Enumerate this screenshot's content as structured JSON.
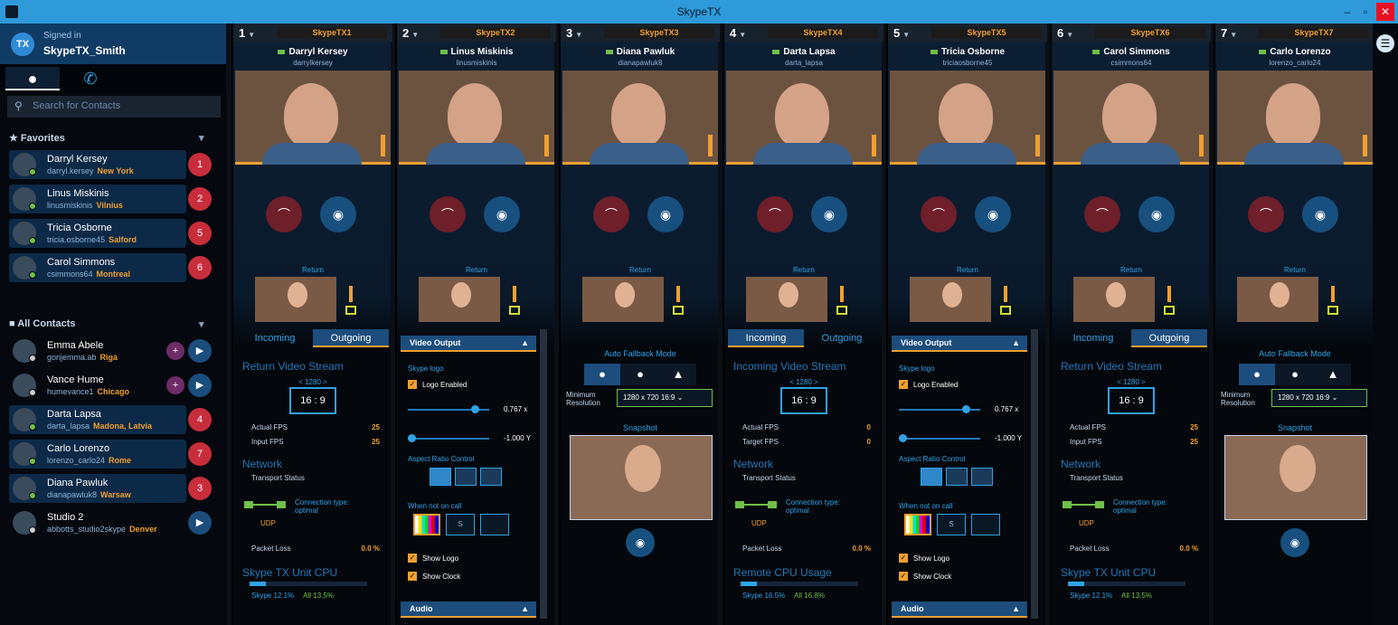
{
  "window": {
    "title": "SkypeTX",
    "minimize": "–",
    "maximize": "▫",
    "close": "✕"
  },
  "user": {
    "badge": "TX",
    "signed_in": "Signed in",
    "name": "SkypeTX_Smith"
  },
  "search": {
    "placeholder": "Search for Contacts"
  },
  "favorites": {
    "title": "Favorites",
    "items": [
      {
        "name": "Darryl Kersey",
        "handle": "darryl.kersey",
        "city": "New York",
        "call": "1",
        "presence": "online"
      },
      {
        "name": "Linus Miskinis",
        "handle": "linusmiskinis",
        "city": "Vilnius",
        "call": "2",
        "presence": "online"
      },
      {
        "name": "Tricia Osborne",
        "handle": "tricia.osborne45",
        "city": "Salford",
        "call": "5",
        "presence": "online"
      },
      {
        "name": "Carol Simmons",
        "handle": "csimmons64",
        "city": "Montreal",
        "call": "6",
        "presence": "online"
      }
    ]
  },
  "all_contacts": {
    "title": "All Contacts",
    "items": [
      {
        "name": "Emma Abele",
        "handle": "gorijemma.ab",
        "city": "Riga",
        "call": "",
        "presence": "offline",
        "mini": "+"
      },
      {
        "name": "Vance Hume",
        "handle": "humevance1",
        "city": "Chicago",
        "call": "",
        "presence": "offline",
        "mini": "+"
      },
      {
        "name": "Darta Lapsa",
        "handle": "darta_lapsa",
        "city": "Madona, Latvia",
        "call": "4",
        "presence": "online",
        "mini": ""
      },
      {
        "name": "Carlo Lorenzo",
        "handle": "lorenzo_carlo24",
        "city": "Rome",
        "call": "7",
        "presence": "online",
        "mini": ""
      },
      {
        "name": "Diana Pawluk",
        "handle": "dianapawluk8",
        "city": "Warsaw",
        "call": "3",
        "presence": "online",
        "mini": ""
      },
      {
        "name": "Studio 2",
        "handle": "abbotts_studio2skype",
        "city": "Denver",
        "call": "",
        "presence": "offline",
        "mini": ""
      }
    ]
  },
  "channels": [
    {
      "num": "1",
      "tx": "SkypeTX1",
      "caller": "Darryl Kersey",
      "handle": "darrylkersey",
      "mode": "stream",
      "tab_in": "Incoming",
      "tab_out": "Outgoing",
      "active_tab": "out",
      "stream_title": "Return Video Stream",
      "res": "< 1280 >",
      "aspect": "16 : 9",
      "fps1_l": "Actual FPS",
      "fps1_v": "25",
      "fps2_l": "Input FPS",
      "fps2_v": "25",
      "net": "Network",
      "transport": "Transport Status",
      "ctype": "Connection type: optimal",
      "udp": "UDP",
      "packet_loss": "Packet Loss",
      "packet_loss_v": "0.0 %",
      "cpu": "Skype TX Unit CPU",
      "cpu_skype": "Skype 12.1%",
      "cpu_sys": "All 13.5%"
    },
    {
      "num": "2",
      "tx": "SkypeTX2",
      "caller": "Linus Miskinis",
      "handle": "linusmiskinis",
      "mode": "output"
    },
    {
      "num": "3",
      "tx": "SkypeTX3",
      "caller": "Diana Pawluk",
      "handle": "dianapawluk8",
      "mode": "fallback",
      "res_dd": "1280 x 720  16:9 ⌄"
    },
    {
      "num": "4",
      "tx": "SkypeTX4",
      "caller": "Darta Lapsa",
      "handle": "darta_lapsa",
      "mode": "stream",
      "tab_in": "Incoming",
      "tab_out": "Outgoing",
      "active_tab": "in",
      "stream_title": "Incoming Video Stream",
      "res": "< 1280 >",
      "aspect": "16 : 9",
      "fps1_l": "Actual FPS",
      "fps1_v": "0",
      "fps2_l": "Target FPS",
      "fps2_v": "0",
      "net": "Network",
      "transport": "Transport Status",
      "ctype": "Connection type: optimal",
      "udp": "UDP",
      "packet_loss": "Packet Loss",
      "packet_loss_v": "0.0 %",
      "cpu": "Remote CPU Usage",
      "cpu_skype": "Skype 16.5%",
      "cpu_sys": "All 16.8%"
    },
    {
      "num": "5",
      "tx": "SkypeTX5",
      "caller": "Tricia Osborne",
      "handle": "triciaosborne45",
      "mode": "output"
    },
    {
      "num": "6",
      "tx": "SkypeTX6",
      "caller": "Carol Simmons",
      "handle": "csimmons64",
      "mode": "stream",
      "tab_in": "Incoming",
      "tab_out": "Outgoing",
      "active_tab": "out",
      "stream_title": "Return Video Stream",
      "res": "< 1280 >",
      "aspect": "16 : 9",
      "fps1_l": "Actual FPS",
      "fps1_v": "25",
      "fps2_l": "Input FPS",
      "fps2_v": "25",
      "net": "Network",
      "transport": "Transport Status",
      "ctype": "Connection type: optimal",
      "udp": "UDP",
      "packet_loss": "Packet Loss",
      "packet_loss_v": "0.0 %",
      "cpu": "Skype TX Unit CPU",
      "cpu_skype": "Skype 12.1%",
      "cpu_sys": "All 13.5%"
    },
    {
      "num": "7",
      "tx": "SkypeTX7",
      "caller": "Carlo Lorenzo",
      "handle": "lorenzo_carlo24",
      "mode": "fallback",
      "res_dd": "1280 x 720  16:9 ⌄"
    }
  ],
  "common": {
    "return": "Return",
    "video_output": "Video Output",
    "skype_logo": "Skype logo",
    "logo_enabled": "Logo Enabled",
    "slider1_v": "0.767 x",
    "slider2_v": "-1.000 Y",
    "aspect_ratio_control": "Aspect Ratio Control",
    "when_not_on_call": "When not on call",
    "show_logo": "Show Logo",
    "show_clock": "Show Clock",
    "audio": "Audio",
    "auto_fallback": "Auto Fallback Mode",
    "min_res": "Minimum Resolution",
    "snapshot": "Snapshot"
  },
  "icons": {
    "contacts": "person-icon",
    "calls": "phone-icon",
    "menu": "hamburger-icon"
  }
}
